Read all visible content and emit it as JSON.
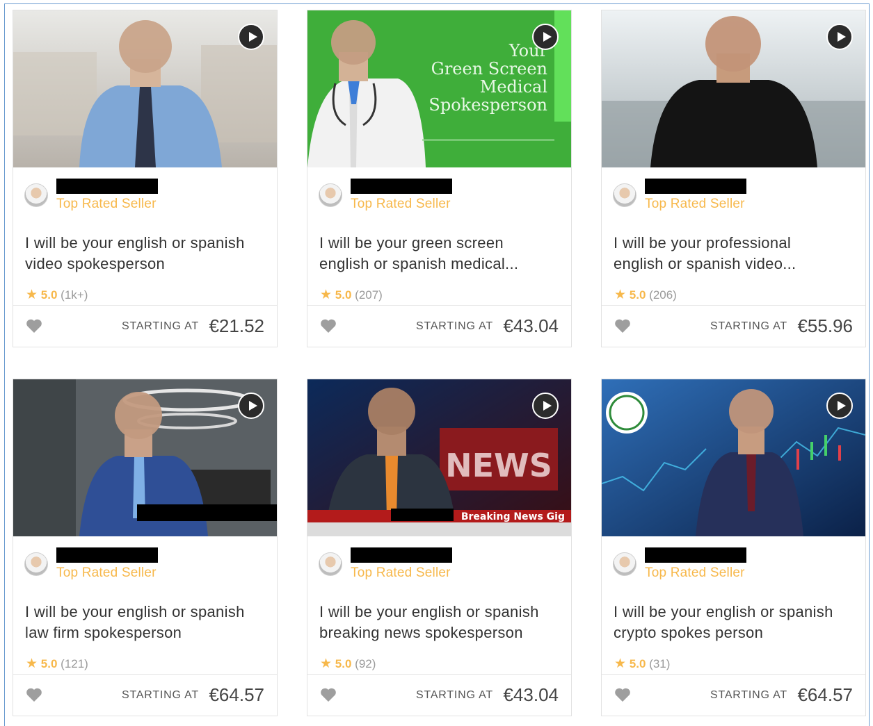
{
  "cards": [
    {
      "level": "Top Rated Seller",
      "title_line1": "I will be your english or spanish",
      "title_line2": "video spokesperson",
      "score": "5.0",
      "reviews": "(1k+)",
      "starting_label": "STARTING AT",
      "price": "€21.52"
    },
    {
      "level": "Top Rated Seller",
      "title_line1": "I will be your green screen",
      "title_line2": "english or spanish medical...",
      "score": "5.0",
      "reviews": "(207)",
      "starting_label": "STARTING AT",
      "price": "€43.04",
      "thumb_text": {
        "line1": "Your",
        "line2": "Green Screen",
        "line3": "Medical",
        "line4": "Spokesperson"
      }
    },
    {
      "level": "Top Rated Seller",
      "title_line1": "I will be your professional",
      "title_line2": "english or spanish video...",
      "score": "5.0",
      "reviews": "(206)",
      "starting_label": "STARTING AT",
      "price": "€55.96"
    },
    {
      "level": "Top Rated Seller",
      "title_line1": "I will be your english or spanish",
      "title_line2": "law firm spokesperson",
      "score": "5.0",
      "reviews": "(121)",
      "starting_label": "STARTING AT",
      "price": "€64.57"
    },
    {
      "level": "Top Rated Seller",
      "title_line1": "I will be your english or spanish",
      "title_line2": "breaking news spokesperson",
      "score": "5.0",
      "reviews": "(92)",
      "starting_label": "STARTING AT",
      "price": "€43.04",
      "thumb_text": {
        "banner": "Breaking News Gig",
        "news": "NEWS"
      }
    },
    {
      "level": "Top Rated Seller",
      "title_line1": "I will be your english or spanish",
      "title_line2": "crypto spokes person",
      "score": "5.0",
      "reviews": "(31)",
      "starting_label": "STARTING AT",
      "price": "€64.57"
    }
  ]
}
